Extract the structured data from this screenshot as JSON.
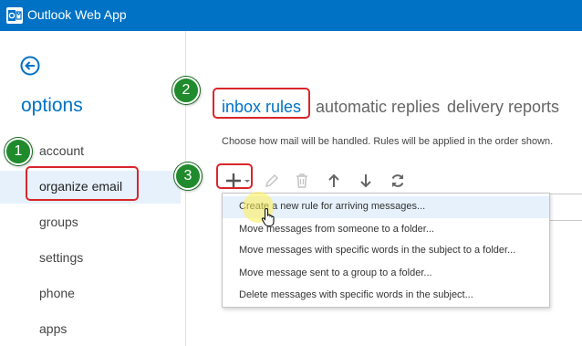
{
  "app": {
    "title": "Outlook Web App"
  },
  "sidebar": {
    "title": "options",
    "items": [
      {
        "label": "account"
      },
      {
        "label": "organize email",
        "selected": true
      },
      {
        "label": "groups"
      },
      {
        "label": "settings"
      },
      {
        "label": "phone"
      },
      {
        "label": "apps"
      }
    ]
  },
  "tabs": [
    {
      "label": "inbox rules",
      "active": true
    },
    {
      "label": "automatic replies"
    },
    {
      "label": "delivery reports"
    }
  ],
  "main": {
    "description": "Choose how mail will be handled. Rules will be applied in the order shown."
  },
  "toolbar": {
    "icons": [
      "new-icon",
      "edit-icon",
      "delete-icon",
      "move-up-icon",
      "move-down-icon",
      "refresh-icon"
    ]
  },
  "new_menu": {
    "items": [
      {
        "label": "Create a new rule for arriving messages...",
        "hovered": true
      },
      {
        "label": "Move messages from someone to a folder..."
      },
      {
        "label": "Move messages with specific words in the subject to a folder..."
      },
      {
        "label": "Move message sent to a group to a folder..."
      },
      {
        "label": "Delete messages with specific words in the subject..."
      }
    ]
  },
  "annotations": {
    "steps": [
      "1",
      "2",
      "3"
    ],
    "highlight_color": "#d9262b",
    "badge_color": "#1f8b2c"
  },
  "colors": {
    "brand": "#0072c6",
    "selected_bg": "#e6f1fb"
  }
}
